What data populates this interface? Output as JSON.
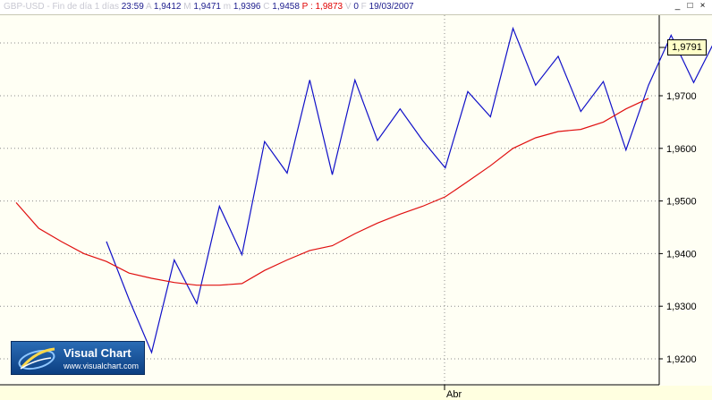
{
  "header": {
    "symbol": "GBP-USD - Fin de día 1 días",
    "time": "23:59",
    "a_label": "A",
    "a_value": "1,9412",
    "m_label": "M",
    "m_value": "1,9471",
    "mi_label": "m",
    "mi_value": "1,9396",
    "c_label": "C",
    "c_value": "1,9458",
    "p_label": "P :",
    "p_value": "1,9873",
    "v_label": "V",
    "v_value": "0",
    "f_label": "F",
    "date": "19/03/2007"
  },
  "window_buttons": {
    "minimize": "_",
    "restore": "□",
    "close": "×"
  },
  "current_price": "1,9791",
  "logo": {
    "title": "Visual Chart",
    "url": "www.visualchart.com"
  },
  "colors": {
    "price": "#1010c8",
    "average": "#e01010",
    "grid": "#8c8c8c",
    "background": "#fffff4"
  },
  "chart_data": {
    "type": "line",
    "y_ticks": [
      "1,9700",
      "1,9600",
      "1,9500",
      "1,9400",
      "1,9300",
      "1,9200"
    ],
    "x_ticks": [
      "Abr"
    ],
    "ylim": [
      1.9175,
      1.9855
    ],
    "series": [
      {
        "points": [
          [
            0,
            1.9423
          ],
          [
            1,
            1.9313
          ],
          [
            2,
            1.9212
          ],
          [
            3,
            1.9388
          ],
          [
            4,
            1.9305
          ],
          [
            5,
            1.949
          ],
          [
            6,
            1.9398
          ],
          [
            7,
            1.9613
          ],
          [
            8,
            1.9553
          ],
          [
            9,
            1.973
          ],
          [
            10,
            1.955
          ],
          [
            11,
            1.973
          ],
          [
            12,
            1.9615
          ],
          [
            13,
            1.9675
          ],
          [
            14,
            1.9615
          ],
          [
            15,
            1.9563
          ],
          [
            16,
            1.9708
          ],
          [
            17,
            1.966
          ],
          [
            18,
            1.9828
          ],
          [
            19,
            1.972
          ],
          [
            20,
            1.9775
          ],
          [
            21,
            1.967
          ],
          [
            22,
            1.9727
          ],
          [
            23,
            1.9597
          ],
          [
            24,
            1.972
          ],
          [
            25,
            1.9815
          ],
          [
            26,
            1.9725
          ],
          [
            27,
            1.981
          ]
        ]
      },
      {
        "points": [
          [
            -4,
            1.9497
          ],
          [
            -3,
            1.9448
          ],
          [
            -2,
            1.9423
          ],
          [
            -1,
            1.94
          ],
          [
            0,
            1.9385
          ],
          [
            1,
            1.9363
          ],
          [
            2,
            1.9353
          ],
          [
            3,
            1.9345
          ],
          [
            4,
            1.934
          ],
          [
            5,
            1.934
          ],
          [
            6,
            1.9343
          ],
          [
            7,
            1.9368
          ],
          [
            8,
            1.9388
          ],
          [
            9,
            1.9406
          ],
          [
            10,
            1.9415
          ],
          [
            11,
            1.9438
          ],
          [
            12,
            1.9458
          ],
          [
            13,
            1.9475
          ],
          [
            14,
            1.949
          ],
          [
            15,
            1.9508
          ],
          [
            16,
            1.9537
          ],
          [
            17,
            1.9567
          ],
          [
            18,
            1.96
          ],
          [
            19,
            1.962
          ],
          [
            20,
            1.9632
          ],
          [
            21,
            1.9636
          ],
          [
            22,
            1.965
          ],
          [
            23,
            1.9675
          ],
          [
            24,
            1.9695
          ]
        ]
      }
    ]
  }
}
